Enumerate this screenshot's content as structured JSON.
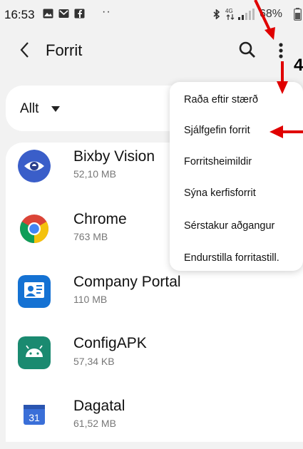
{
  "status_bar": {
    "time": "16:53",
    "dots": "··",
    "network": "4G",
    "battery": "68%"
  },
  "app_bar": {
    "title": "Forrit"
  },
  "filter": {
    "label": "Allt"
  },
  "apps": [
    {
      "name": "Bixby Vision",
      "size": "52,10 MB",
      "icon": "bixby-vision-icon",
      "color": "#3a5ec9"
    },
    {
      "name": "Chrome",
      "size": "763 MB",
      "icon": "chrome-icon",
      "color": "#db4437"
    },
    {
      "name": "Company Portal",
      "size": "110 MB",
      "icon": "company-portal-icon",
      "color": "#1572d3"
    },
    {
      "name": "ConfigAPK",
      "size": "57,34 KB",
      "icon": "android-icon",
      "color": "#1a8a70"
    },
    {
      "name": "Dagatal",
      "size": "61,52 MB",
      "icon": "calendar-icon",
      "color": "#3a6fd8"
    }
  ],
  "menu": {
    "items": [
      {
        "label": "Raða eftir stærð"
      },
      {
        "label": "Sjálfgefin forrit"
      },
      {
        "label": "Forritsheimildir"
      },
      {
        "label": "Sýna kerfisforrit"
      },
      {
        "label": "Sérstakur aðgangur"
      },
      {
        "label": "Endurstilla forritastill."
      }
    ]
  },
  "annotation": {
    "step_number": "4",
    "arrow_color": "#e00000"
  }
}
